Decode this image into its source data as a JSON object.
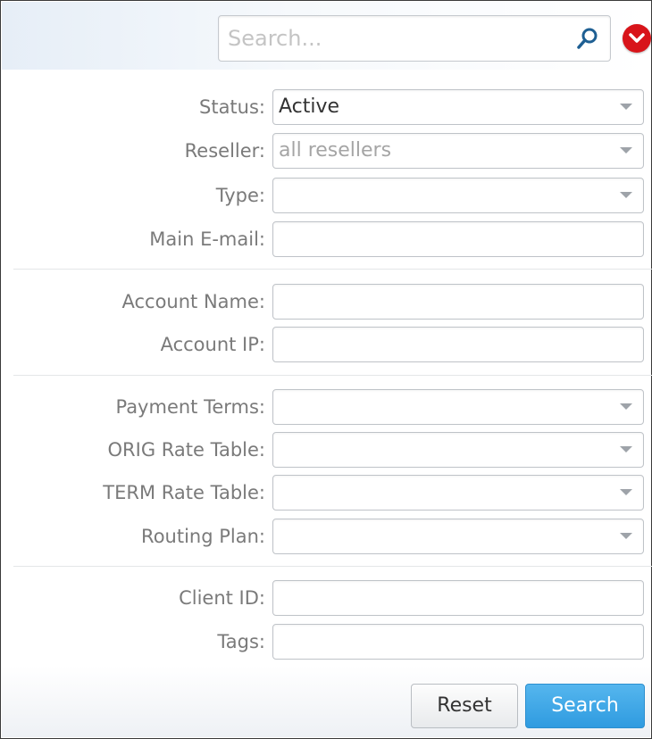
{
  "search": {
    "placeholder": "Search...",
    "value": ""
  },
  "filters": {
    "status": {
      "label": "Status:",
      "value": "Active"
    },
    "reseller": {
      "label": "Reseller:",
      "value": "all resellers"
    },
    "type": {
      "label": "Type:",
      "value": ""
    },
    "main_email": {
      "label": "Main E-mail:",
      "value": ""
    },
    "account_name": {
      "label": "Account Name:",
      "value": ""
    },
    "account_ip": {
      "label": "Account IP:",
      "value": ""
    },
    "payment_terms": {
      "label": "Payment Terms:",
      "value": ""
    },
    "orig_rate_table": {
      "label": "ORIG Rate Table:",
      "value": ""
    },
    "term_rate_table": {
      "label": "TERM Rate Table:",
      "value": ""
    },
    "routing_plan": {
      "label": "Routing Plan:",
      "value": ""
    },
    "client_id": {
      "label": "Client ID:",
      "value": ""
    },
    "tags": {
      "label": "Tags:",
      "value": ""
    }
  },
  "buttons": {
    "reset": "Reset",
    "search": "Search"
  },
  "colors": {
    "collapse_button": "#d8141a",
    "search_button": "#2f9be0",
    "label_text": "#7a7a7a"
  },
  "icons": {
    "search": "magnifier-icon",
    "collapse": "chevron-down-icon",
    "dropdown": "caret-down-icon"
  }
}
